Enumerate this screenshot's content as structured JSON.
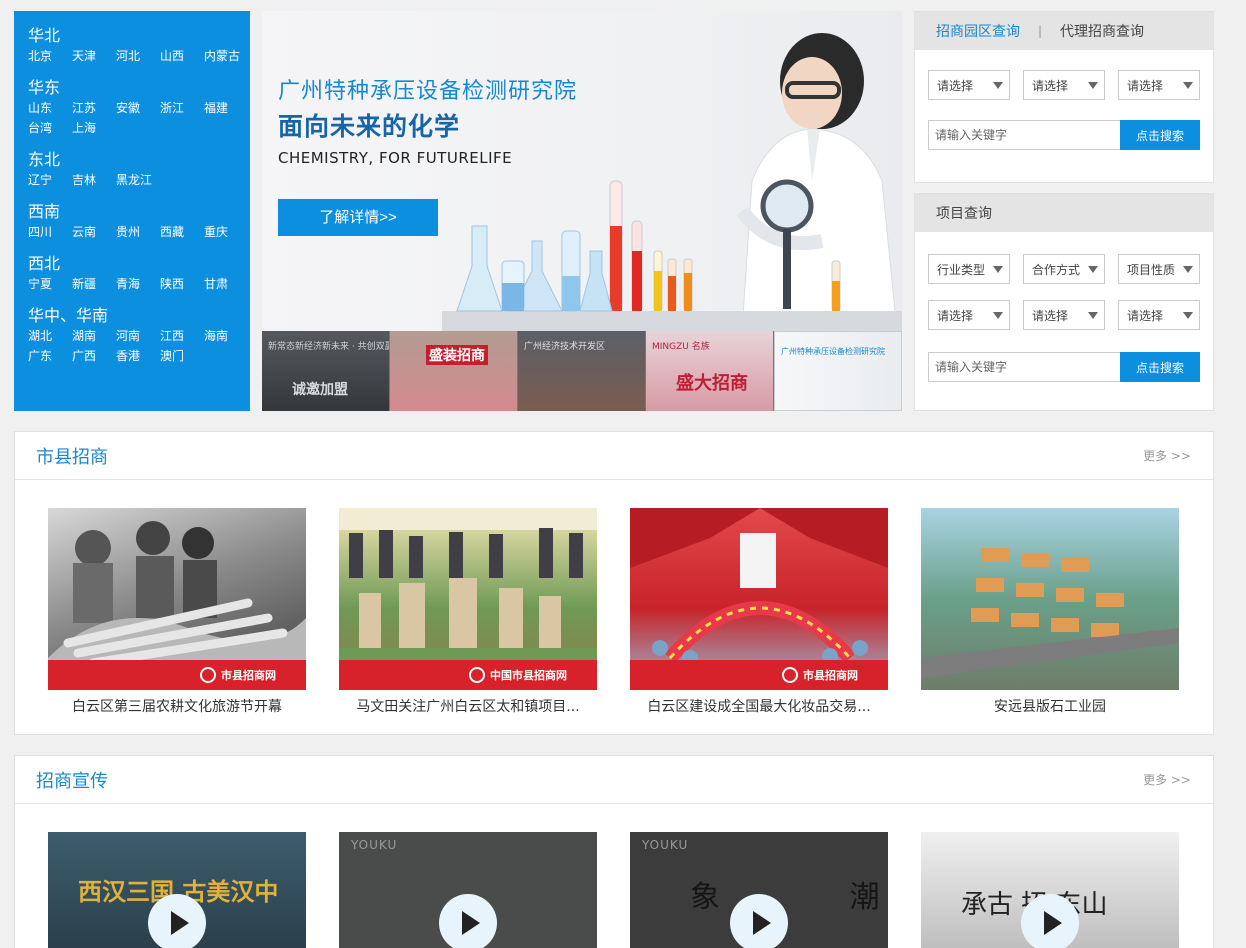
{
  "regions": [
    {
      "name": "华北",
      "cities": [
        "北京",
        "天津",
        "河北",
        "山西",
        "内蒙古"
      ]
    },
    {
      "name": "华东",
      "cities": [
        "山东",
        "江苏",
        "安徽",
        "浙江",
        "福建",
        "台湾",
        "上海"
      ]
    },
    {
      "name": "东北",
      "cities": [
        "辽宁",
        "吉林",
        "黑龙江"
      ]
    },
    {
      "name": "西南",
      "cities": [
        "四川",
        "云南",
        "贵州",
        "西藏",
        "重庆"
      ]
    },
    {
      "name": "西北",
      "cities": [
        "宁夏",
        "新疆",
        "青海",
        "陕西",
        "甘肃"
      ]
    },
    {
      "name": "华中、华南",
      "cities": [
        "湖北",
        "湖南",
        "河南",
        "江西",
        "海南",
        "广东",
        "广西",
        "香港",
        "澳门"
      ]
    }
  ],
  "banner": {
    "title": "广州特种承压设备检测研究院",
    "subtitle": "面向未来的化学",
    "english": "CHEMISTRY, FOR FUTURELIFE",
    "button": "了解详情>>"
  },
  "thumbnails": [
    {
      "caption": "新常态新经济新未来 · 共创双赢新格局",
      "big": "诚邀加盟"
    },
    {
      "caption": "",
      "big": "盛装招商"
    },
    {
      "caption": "广州经济技术开发区",
      "big": ""
    },
    {
      "caption": "MINGZU 名族",
      "big": "盛大招商"
    },
    {
      "caption": "广州特种承压设备检测研究院",
      "big": ""
    }
  ],
  "park_search": {
    "tab_active": "招商园区查询",
    "tab_sep": "|",
    "tab_other": "代理招商查询",
    "selects": [
      "请选择",
      "请选择",
      "请选择"
    ],
    "keyword_placeholder": "请输入关键字",
    "button": "点击搜索"
  },
  "project_search": {
    "title": "项目查询",
    "row1": [
      "行业类型",
      "合作方式",
      "项目性质"
    ],
    "row2": [
      "请选择",
      "请选择",
      "请选择"
    ],
    "keyword_placeholder": "请输入关键字",
    "button": "点击搜索"
  },
  "county_section": {
    "title": "市县招商",
    "more": "更多 >>",
    "watermark_1": "市县招商网",
    "watermark_2": "中国市县招商网",
    "watermark_3": "市县招商网",
    "items": [
      "白云区第三届农耕文化旅游节开幕",
      "马文田关注广州白云区太和镇项目...",
      "白云区建设成全国最大化妆品交易...",
      "安远县版石工业园"
    ]
  },
  "promo_section": {
    "title": "招商宣传",
    "more": "更多 >>",
    "video_1_text": "西汉三国 古美汉中",
    "video_2_mark": "YOUKU",
    "video_3_mark": "YOUKU",
    "video_3_text": "象 潮",
    "video_4_text": "承古 招 东山"
  },
  "colors": {
    "primary": "#0d8fe0",
    "link": "#1788d0",
    "watermark": "#d7212b"
  }
}
